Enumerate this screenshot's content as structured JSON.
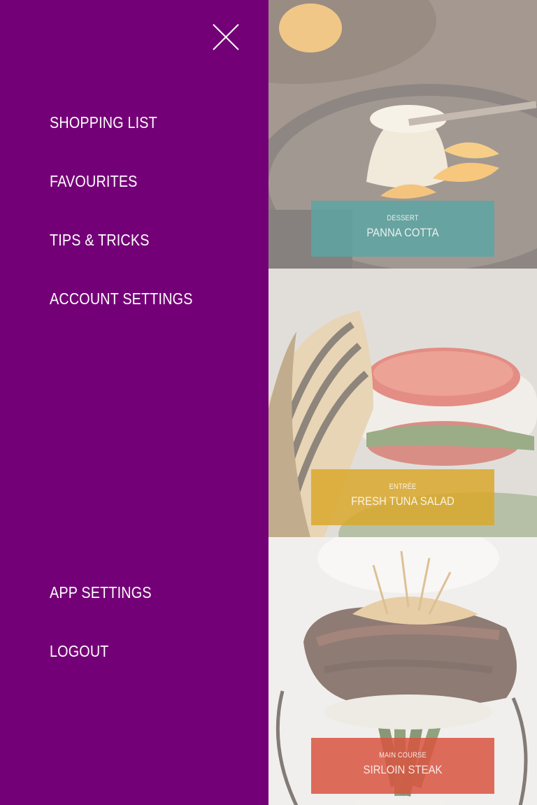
{
  "colors": {
    "menu_background": "#740077",
    "menu_text": "#ffffff",
    "dessert_label": "#5aa6a4",
    "entree_label": "#d9a82b",
    "main_course_label": "#d9543f"
  },
  "menu": {
    "close_icon": "close-icon",
    "items": [
      {
        "label": "SHOPPING LIST"
      },
      {
        "label": "FAVOURITES"
      },
      {
        "label": "TIPS & TRICKS"
      },
      {
        "label": "ACCOUNT SETTINGS"
      }
    ],
    "bottom_items": [
      {
        "label": "APP SETTINGS"
      },
      {
        "label": "LOGOUT"
      }
    ]
  },
  "recipes": [
    {
      "course": "DESSERT",
      "dish": "PANNA COTTA",
      "image": "panna-cotta-photo"
    },
    {
      "course": "ENTRÉE",
      "dish": "FRESH TUNA SALAD",
      "image": "tuna-salad-photo"
    },
    {
      "course": "MAIN COURSE",
      "dish": "SIRLOIN STEAK",
      "image": "sirloin-steak-photo"
    }
  ]
}
